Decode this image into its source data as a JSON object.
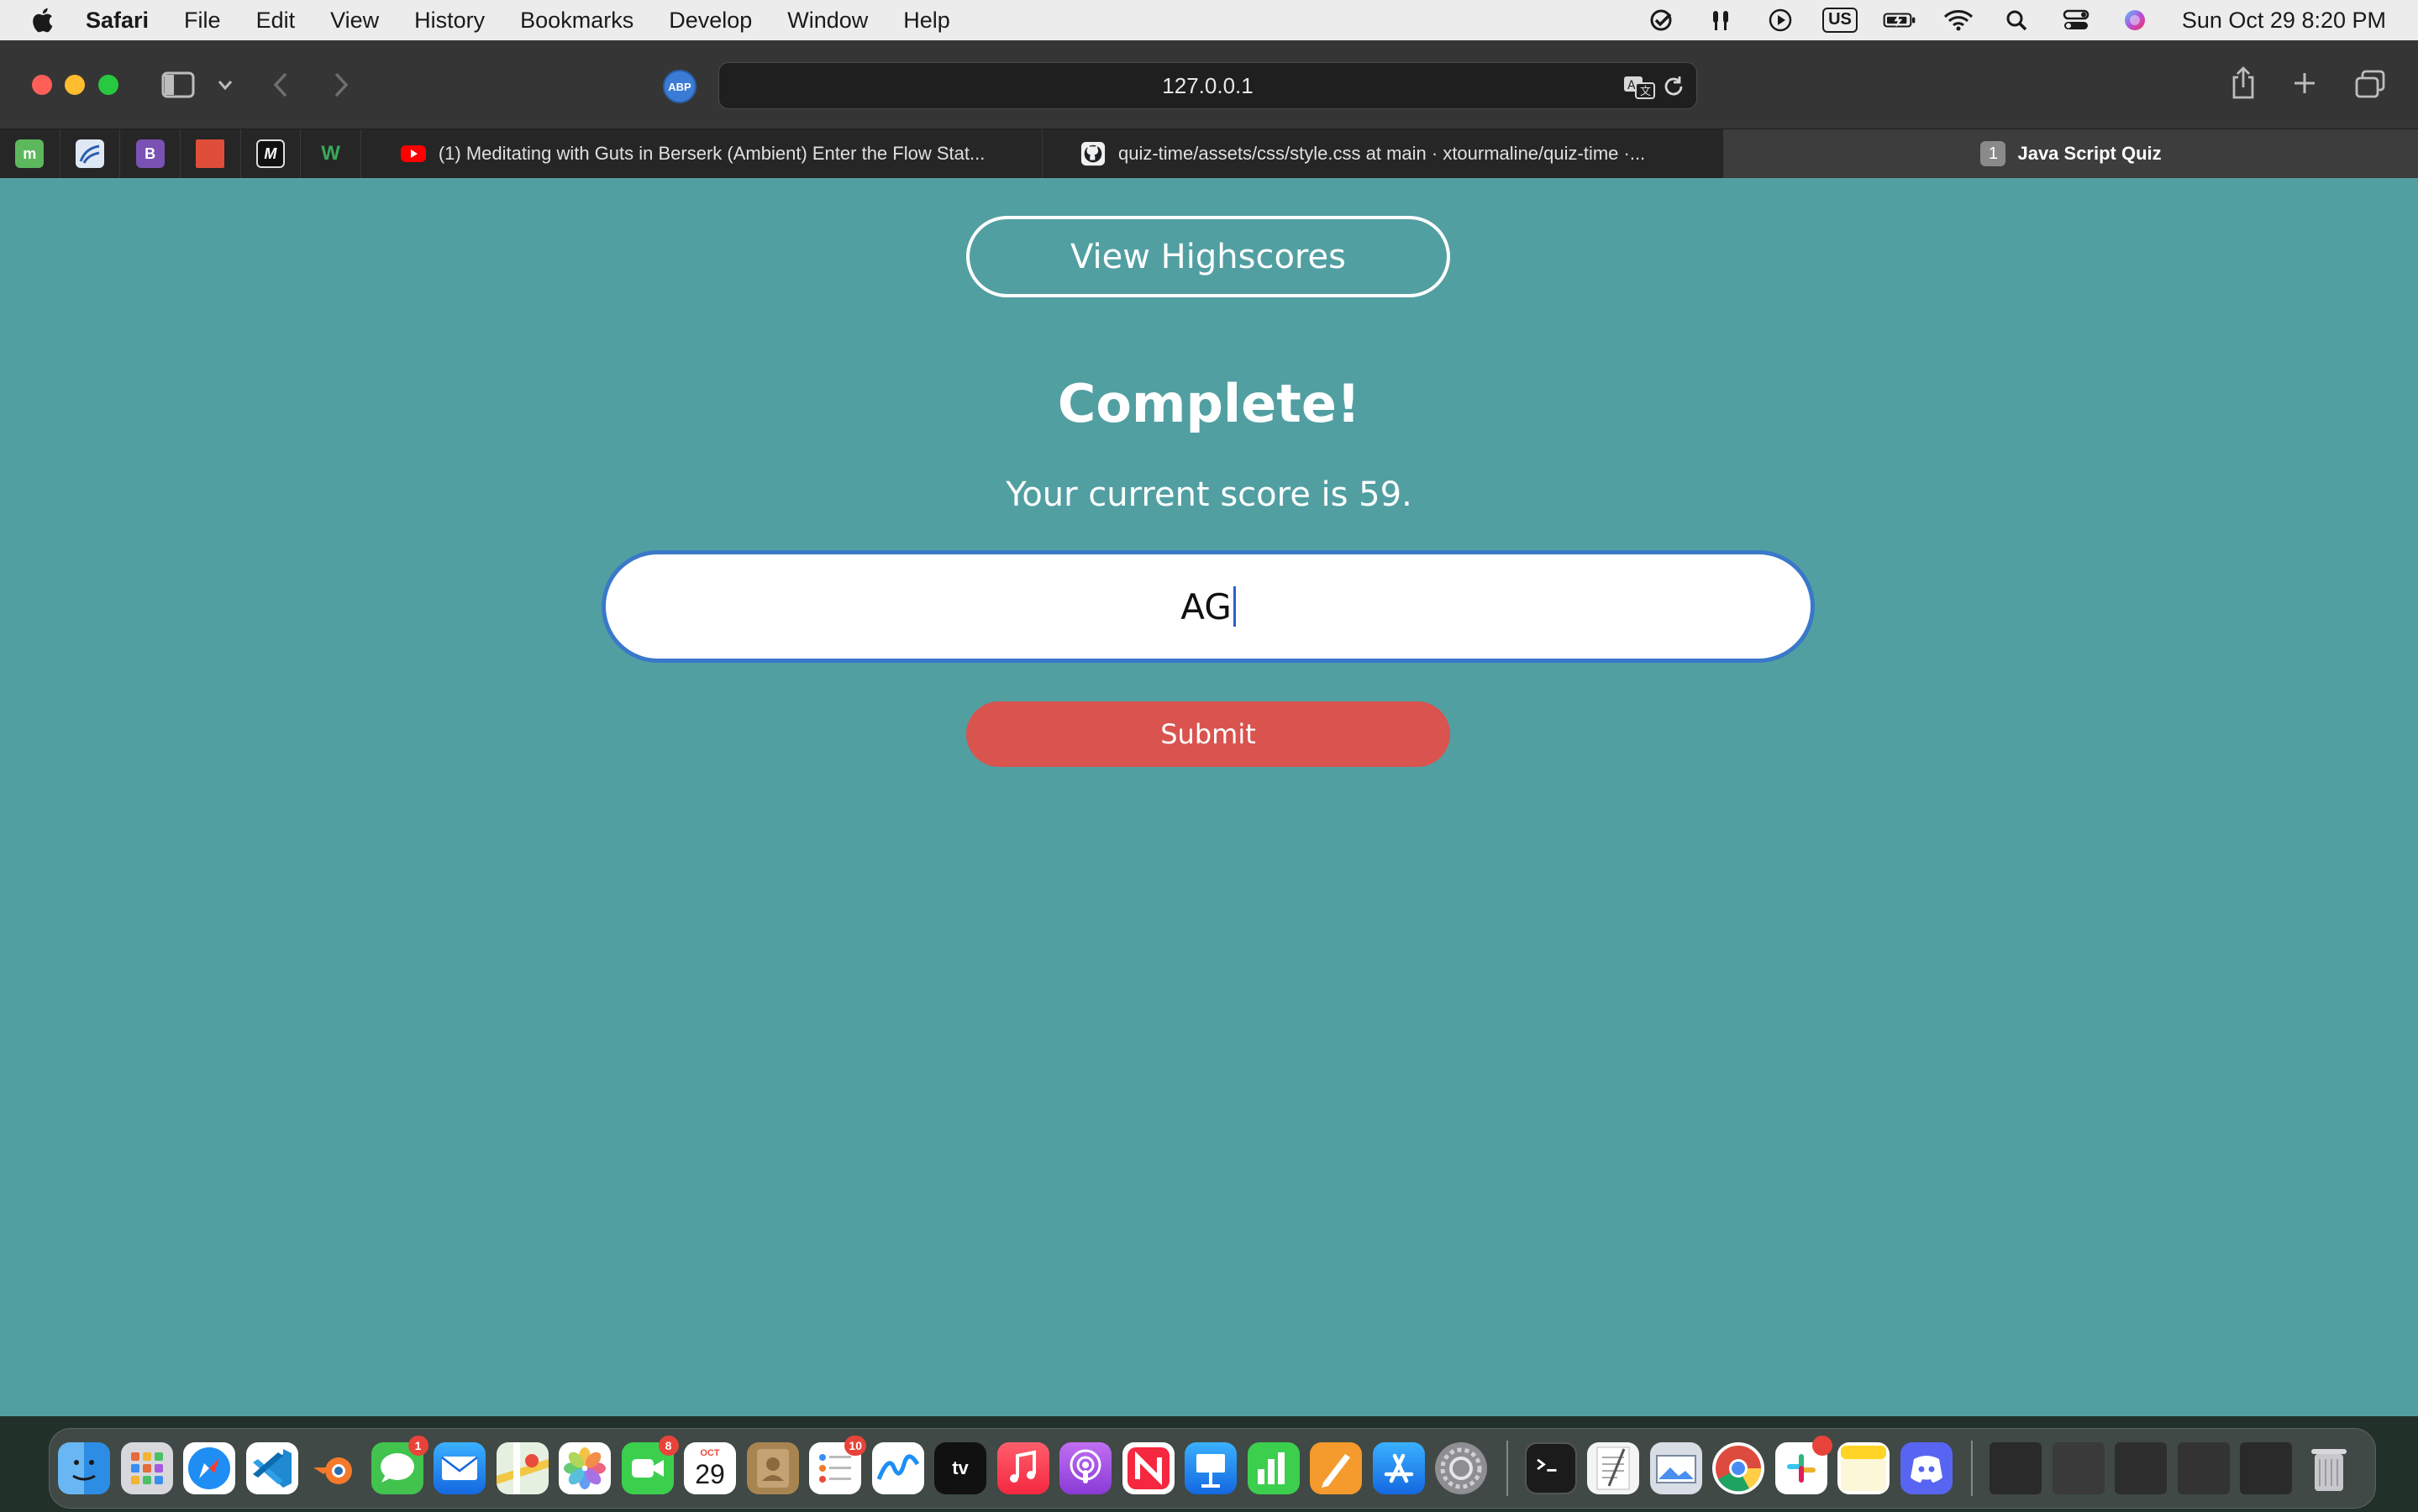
{
  "menubar": {
    "app_name": "Safari",
    "items": [
      "File",
      "Edit",
      "View",
      "History",
      "Bookmarks",
      "Develop",
      "Window",
      "Help"
    ],
    "keyboard_layout": "US",
    "clock": "Sun Oct 29  8:20 PM"
  },
  "toolbar": {
    "extension_label": "ABP",
    "url": "127.0.0.1"
  },
  "tabs": [
    {
      "title": "(1) Meditating with Guts in Berserk (Ambient) Enter the Flow Stat...",
      "icon": "youtube-icon"
    },
    {
      "title": "quiz-time/assets/css/style.css at main · xtourmaline/quiz-time ·...",
      "icon": "github-icon"
    },
    {
      "title": "Java Script Quiz",
      "badge": "1",
      "active": true
    }
  ],
  "favorites": [
    "m",
    "wave",
    "B",
    "arc",
    "M",
    "W"
  ],
  "page": {
    "highscores_label": "View Highscores",
    "heading": "Complete!",
    "score_text": "Your current score is 59.",
    "initials_value": "AG",
    "submit_label": "Submit",
    "background_color": "#529fa2",
    "submit_color": "#d9534f"
  },
  "dock": {
    "messages_badge": "1",
    "facetime_badge": "8",
    "calendar_month": "OCT",
    "calendar_day": "29",
    "reminders_badge": "10",
    "apple_tv_label": "tv"
  }
}
